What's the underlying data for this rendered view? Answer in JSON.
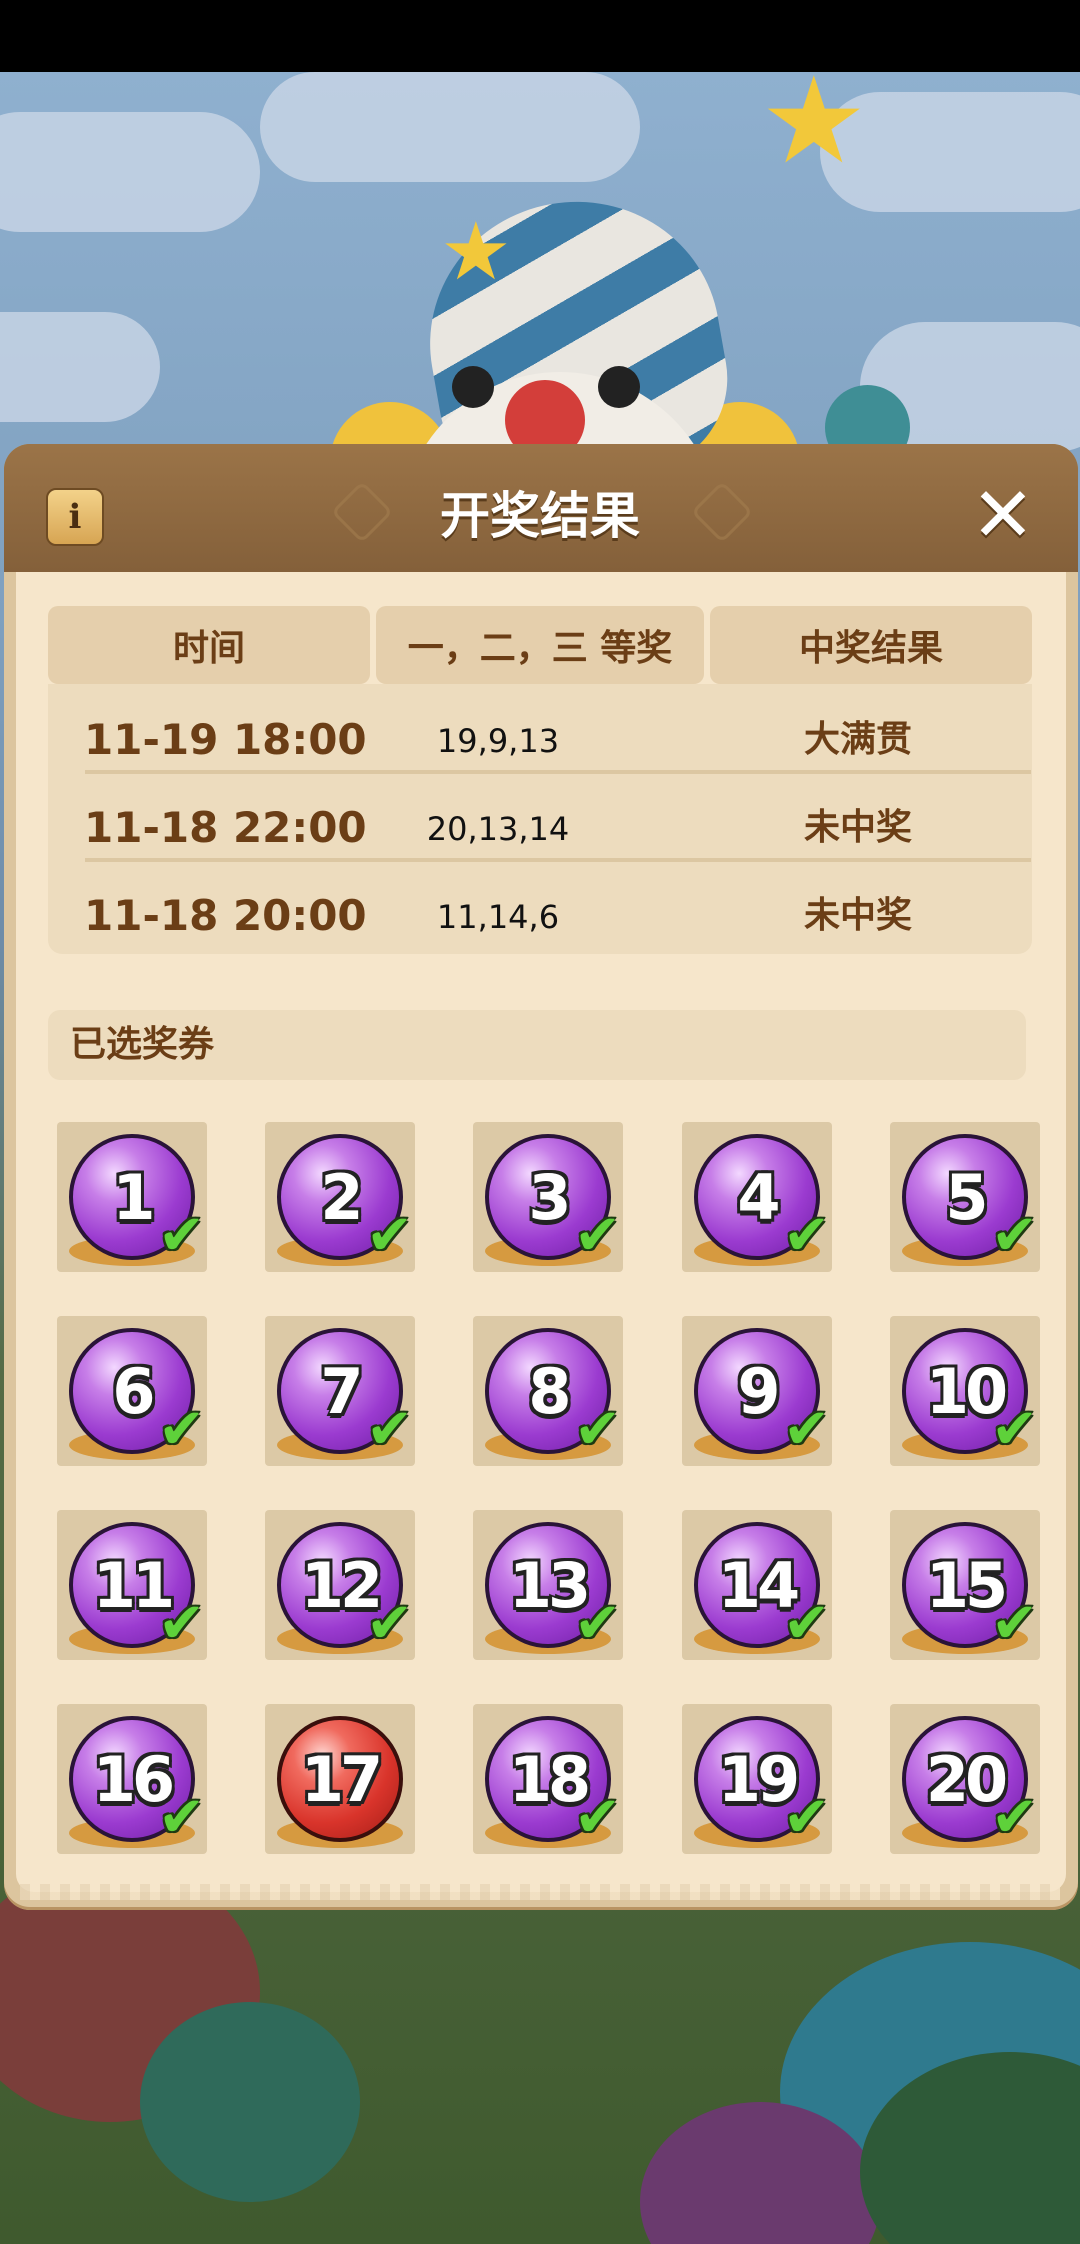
{
  "dialog": {
    "title": "开奖结果",
    "info_icon": "info-icon",
    "close_icon": "close-icon",
    "close_glyph": "✕"
  },
  "results_table": {
    "headers": [
      "时间",
      "一，二，三 等奖",
      "中奖结果"
    ],
    "rows": [
      {
        "time": "11-19 18:00",
        "numbers": "19,9,13",
        "result": "大满贯"
      },
      {
        "time": "11-18 22:00",
        "numbers": "20,13,14",
        "result": "未中奖"
      },
      {
        "time": "11-18 20:00",
        "numbers": "11,14,6",
        "result": "未中奖"
      }
    ]
  },
  "selected_tickets": {
    "label": "已选奖券",
    "check_glyph": "✔",
    "tickets": [
      {
        "number": "1",
        "color": "purple",
        "checked": true
      },
      {
        "number": "2",
        "color": "purple",
        "checked": true
      },
      {
        "number": "3",
        "color": "purple",
        "checked": true
      },
      {
        "number": "4",
        "color": "purple",
        "checked": true
      },
      {
        "number": "5",
        "color": "purple",
        "checked": true
      },
      {
        "number": "6",
        "color": "purple",
        "checked": true
      },
      {
        "number": "7",
        "color": "purple",
        "checked": true
      },
      {
        "number": "8",
        "color": "purple",
        "checked": true
      },
      {
        "number": "9",
        "color": "purple",
        "checked": true
      },
      {
        "number": "10",
        "color": "purple",
        "checked": true
      },
      {
        "number": "11",
        "color": "purple",
        "checked": true
      },
      {
        "number": "12",
        "color": "purple",
        "checked": true
      },
      {
        "number": "13",
        "color": "purple",
        "checked": true
      },
      {
        "number": "14",
        "color": "purple",
        "checked": true
      },
      {
        "number": "15",
        "color": "purple",
        "checked": true
      },
      {
        "number": "16",
        "color": "purple",
        "checked": true
      },
      {
        "number": "17",
        "color": "red",
        "checked": false
      },
      {
        "number": "18",
        "color": "purple",
        "checked": true
      },
      {
        "number": "19",
        "color": "purple",
        "checked": true
      },
      {
        "number": "20",
        "color": "purple",
        "checked": true
      }
    ]
  }
}
